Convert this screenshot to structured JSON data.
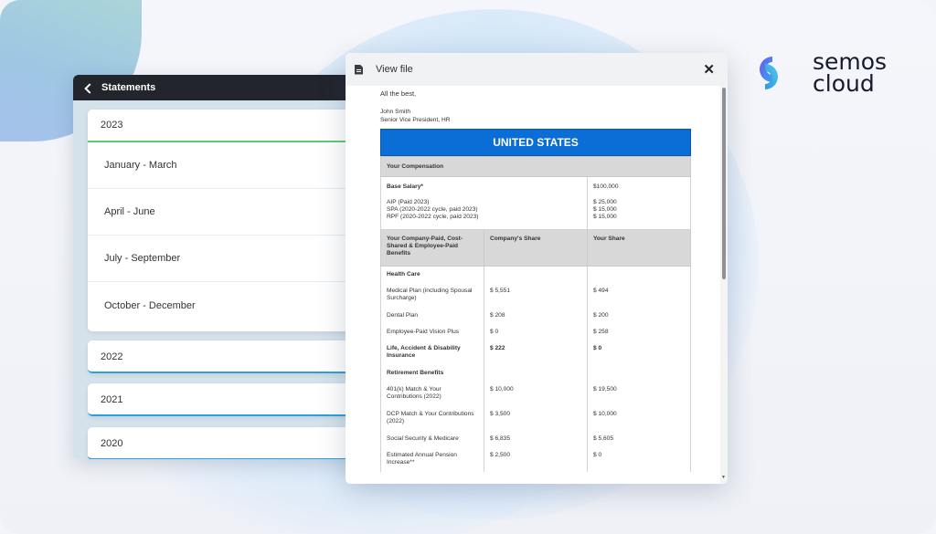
{
  "brand": {
    "name_line1": "semos",
    "name_line2": "cloud",
    "colors": {
      "logo_blue": "#2aa3e8",
      "logo_purple": "#6a4cf0",
      "logo_cyan": "#47c7ee"
    }
  },
  "statements": {
    "title": "Statements",
    "years": [
      {
        "label": "2023",
        "expanded": true,
        "quarters": [
          "January - March",
          "April - June",
          "July - September",
          "October - December"
        ]
      },
      {
        "label": "2022",
        "expanded": false
      },
      {
        "label": "2021",
        "expanded": false
      },
      {
        "label": "2020",
        "expanded": false
      }
    ],
    "colors": {
      "active_underline": "#5fcb72",
      "collapsed_underline": "#2aa2de"
    }
  },
  "viewer": {
    "title": "View file",
    "doc": {
      "signoff": "All the best,",
      "signer_name": "John Smith",
      "signer_title": "Senior Vice President, HR",
      "banner": "UNITED STATES",
      "section_title": "Your Compensation",
      "base_salary_label": "Base Salary*",
      "base_salary_value": "$100,000",
      "incentives": [
        {
          "label": "AIP (Paid 2023)",
          "value": "$ 25,000"
        },
        {
          "label": "SPA (2020-2022 cycle, paid 2023)",
          "value": "$ 15,000"
        },
        {
          "label": "RPF (2020-2022 cycle, paid 2023)",
          "value": "$ 15,000"
        }
      ],
      "columns": [
        "Your Company-Paid, Cost-Shared & Employee-Paid Benefits",
        "Company's Share",
        "Your Share"
      ],
      "groups": [
        {
          "title": "Health Care",
          "rows": [
            {
              "label": "Medical Plan (including Spousal Surcharge)",
              "company": "$ 5,551",
              "you": "$ 494"
            },
            {
              "label": "Dental Plan",
              "company": "$ 208",
              "you": "$ 200"
            },
            {
              "label": "Employee-Paid Vision Plus",
              "company": "$ 0",
              "you": "$ 258"
            },
            {
              "label": "Life, Accident & Disability Insurance",
              "company": "$ 222",
              "you": "$ 0",
              "bold": true
            }
          ]
        },
        {
          "title": "Retirement Benefits",
          "rows": [
            {
              "label": "401(k) Match & Your Contributions (2022)",
              "company": "$ 10,000",
              "you": "$ 19,500"
            },
            {
              "label": "DCP Match & Your Contributions (2022)",
              "company": "$ 3,500",
              "you": "$ 10,000"
            },
            {
              "label": "Social Security & Medicare",
              "company": "$ 6,835",
              "you": "$ 5,605"
            },
            {
              "label": "Estimated Annual Pension Increase**",
              "company": "$ 2,500",
              "you": "$ 0"
            }
          ]
        }
      ],
      "colors": {
        "banner": "#0b6ed6",
        "header_gray": "#d8d8d8"
      }
    }
  }
}
